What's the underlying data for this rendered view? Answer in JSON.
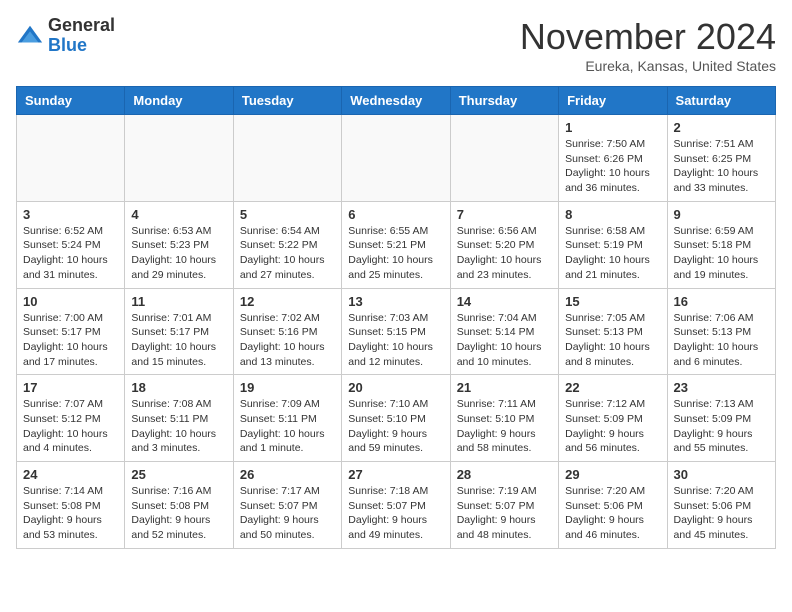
{
  "header": {
    "logo_line1": "General",
    "logo_line2": "Blue",
    "month_title": "November 2024",
    "location": "Eureka, Kansas, United States"
  },
  "weekdays": [
    "Sunday",
    "Monday",
    "Tuesday",
    "Wednesday",
    "Thursday",
    "Friday",
    "Saturday"
  ],
  "weeks": [
    [
      {
        "day": "",
        "info": ""
      },
      {
        "day": "",
        "info": ""
      },
      {
        "day": "",
        "info": ""
      },
      {
        "day": "",
        "info": ""
      },
      {
        "day": "",
        "info": ""
      },
      {
        "day": "1",
        "info": "Sunrise: 7:50 AM\nSunset: 6:26 PM\nDaylight: 10 hours and 36 minutes."
      },
      {
        "day": "2",
        "info": "Sunrise: 7:51 AM\nSunset: 6:25 PM\nDaylight: 10 hours and 33 minutes."
      }
    ],
    [
      {
        "day": "3",
        "info": "Sunrise: 6:52 AM\nSunset: 5:24 PM\nDaylight: 10 hours and 31 minutes."
      },
      {
        "day": "4",
        "info": "Sunrise: 6:53 AM\nSunset: 5:23 PM\nDaylight: 10 hours and 29 minutes."
      },
      {
        "day": "5",
        "info": "Sunrise: 6:54 AM\nSunset: 5:22 PM\nDaylight: 10 hours and 27 minutes."
      },
      {
        "day": "6",
        "info": "Sunrise: 6:55 AM\nSunset: 5:21 PM\nDaylight: 10 hours and 25 minutes."
      },
      {
        "day": "7",
        "info": "Sunrise: 6:56 AM\nSunset: 5:20 PM\nDaylight: 10 hours and 23 minutes."
      },
      {
        "day": "8",
        "info": "Sunrise: 6:58 AM\nSunset: 5:19 PM\nDaylight: 10 hours and 21 minutes."
      },
      {
        "day": "9",
        "info": "Sunrise: 6:59 AM\nSunset: 5:18 PM\nDaylight: 10 hours and 19 minutes."
      }
    ],
    [
      {
        "day": "10",
        "info": "Sunrise: 7:00 AM\nSunset: 5:17 PM\nDaylight: 10 hours and 17 minutes."
      },
      {
        "day": "11",
        "info": "Sunrise: 7:01 AM\nSunset: 5:17 PM\nDaylight: 10 hours and 15 minutes."
      },
      {
        "day": "12",
        "info": "Sunrise: 7:02 AM\nSunset: 5:16 PM\nDaylight: 10 hours and 13 minutes."
      },
      {
        "day": "13",
        "info": "Sunrise: 7:03 AM\nSunset: 5:15 PM\nDaylight: 10 hours and 12 minutes."
      },
      {
        "day": "14",
        "info": "Sunrise: 7:04 AM\nSunset: 5:14 PM\nDaylight: 10 hours and 10 minutes."
      },
      {
        "day": "15",
        "info": "Sunrise: 7:05 AM\nSunset: 5:13 PM\nDaylight: 10 hours and 8 minutes."
      },
      {
        "day": "16",
        "info": "Sunrise: 7:06 AM\nSunset: 5:13 PM\nDaylight: 10 hours and 6 minutes."
      }
    ],
    [
      {
        "day": "17",
        "info": "Sunrise: 7:07 AM\nSunset: 5:12 PM\nDaylight: 10 hours and 4 minutes."
      },
      {
        "day": "18",
        "info": "Sunrise: 7:08 AM\nSunset: 5:11 PM\nDaylight: 10 hours and 3 minutes."
      },
      {
        "day": "19",
        "info": "Sunrise: 7:09 AM\nSunset: 5:11 PM\nDaylight: 10 hours and 1 minute."
      },
      {
        "day": "20",
        "info": "Sunrise: 7:10 AM\nSunset: 5:10 PM\nDaylight: 9 hours and 59 minutes."
      },
      {
        "day": "21",
        "info": "Sunrise: 7:11 AM\nSunset: 5:10 PM\nDaylight: 9 hours and 58 minutes."
      },
      {
        "day": "22",
        "info": "Sunrise: 7:12 AM\nSunset: 5:09 PM\nDaylight: 9 hours and 56 minutes."
      },
      {
        "day": "23",
        "info": "Sunrise: 7:13 AM\nSunset: 5:09 PM\nDaylight: 9 hours and 55 minutes."
      }
    ],
    [
      {
        "day": "24",
        "info": "Sunrise: 7:14 AM\nSunset: 5:08 PM\nDaylight: 9 hours and 53 minutes."
      },
      {
        "day": "25",
        "info": "Sunrise: 7:16 AM\nSunset: 5:08 PM\nDaylight: 9 hours and 52 minutes."
      },
      {
        "day": "26",
        "info": "Sunrise: 7:17 AM\nSunset: 5:07 PM\nDaylight: 9 hours and 50 minutes."
      },
      {
        "day": "27",
        "info": "Sunrise: 7:18 AM\nSunset: 5:07 PM\nDaylight: 9 hours and 49 minutes."
      },
      {
        "day": "28",
        "info": "Sunrise: 7:19 AM\nSunset: 5:07 PM\nDaylight: 9 hours and 48 minutes."
      },
      {
        "day": "29",
        "info": "Sunrise: 7:20 AM\nSunset: 5:06 PM\nDaylight: 9 hours and 46 minutes."
      },
      {
        "day": "30",
        "info": "Sunrise: 7:20 AM\nSunset: 5:06 PM\nDaylight: 9 hours and 45 minutes."
      }
    ]
  ]
}
